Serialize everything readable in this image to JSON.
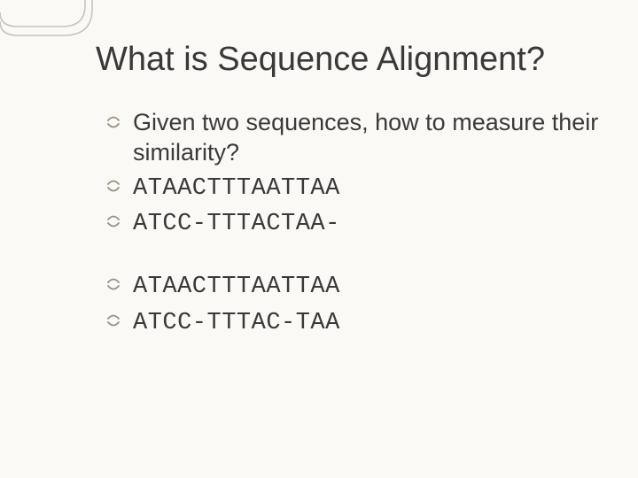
{
  "title": "What is Sequence Alignment?",
  "body": {
    "intro": "Given two sequences, how to measure their similarity?",
    "group1": {
      "seq1": "ATAACTTTAATTAA",
      "seq2": "ATCC-TTTACTAA-"
    },
    "group2": {
      "seq1": "ATAACTTTAATTAA",
      "seq2": "ATCC-TTTAC-TAA"
    }
  }
}
